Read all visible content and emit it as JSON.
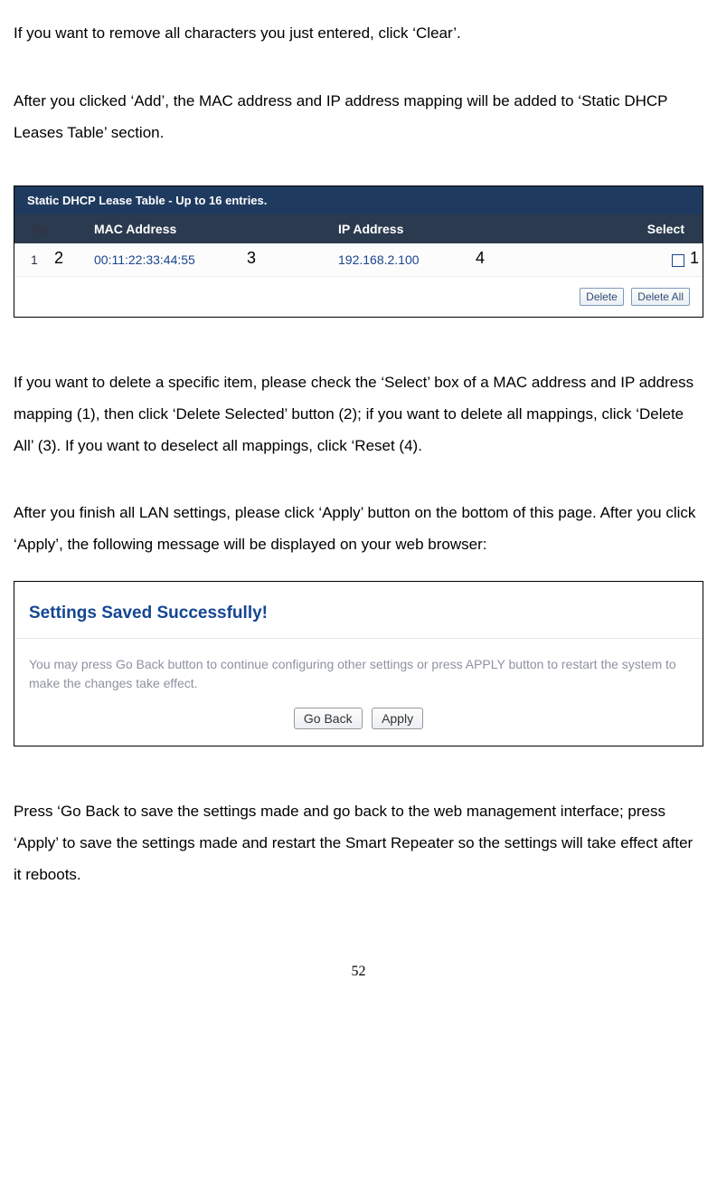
{
  "p1": "If you want to remove all characters you just entered, click ‘Clear’.",
  "p2": "After you clicked ‘Add’, the MAC address and IP address mapping will be added to ‘Static DHCP Leases Table’ section.",
  "figure1": {
    "title": "Static DHCP Lease Table - Up to 16 entries.",
    "header": {
      "no": "No.",
      "mac": "MAC Address",
      "ip": "IP Address",
      "select": "Select"
    },
    "row": {
      "no": "1",
      "mac": "00:11:22:33:44:55",
      "ip": "192.168.2.100"
    },
    "buttons": {
      "delete": "Delete",
      "delete_all": "Delete All"
    },
    "annot": {
      "a1": "1",
      "a2": "2",
      "a3": "3",
      "a4": "4"
    }
  },
  "p3": "If you want to delete a specific item, please check the ‘Select’ box of a MAC address and IP address mapping (1), then click ‘Delete Selected’ button (2); if you want to delete all mappings, click ‘Delete All’ (3). If you want to deselect all mappings, click ‘Reset (4).",
  "p4": "After you finish all LAN settings, please click ‘Apply’ button on the bottom of this page. After you click ‘Apply’, the following message will be displayed on your web browser:",
  "figure2": {
    "title": "Settings Saved Successfully!",
    "body": "You may press Go Back button to continue configuring other settings or press APPLY button to restart the system to make the changes take effect.",
    "buttons": {
      "go_back": "Go Back",
      "apply": "Apply"
    }
  },
  "p5": "Press ‘Go Back to save the settings made and go back to the web management interface; press ‘Apply’ to save the settings made and restart the Smart Repeater so the settings will take effect after it reboots.",
  "page_no": "52"
}
